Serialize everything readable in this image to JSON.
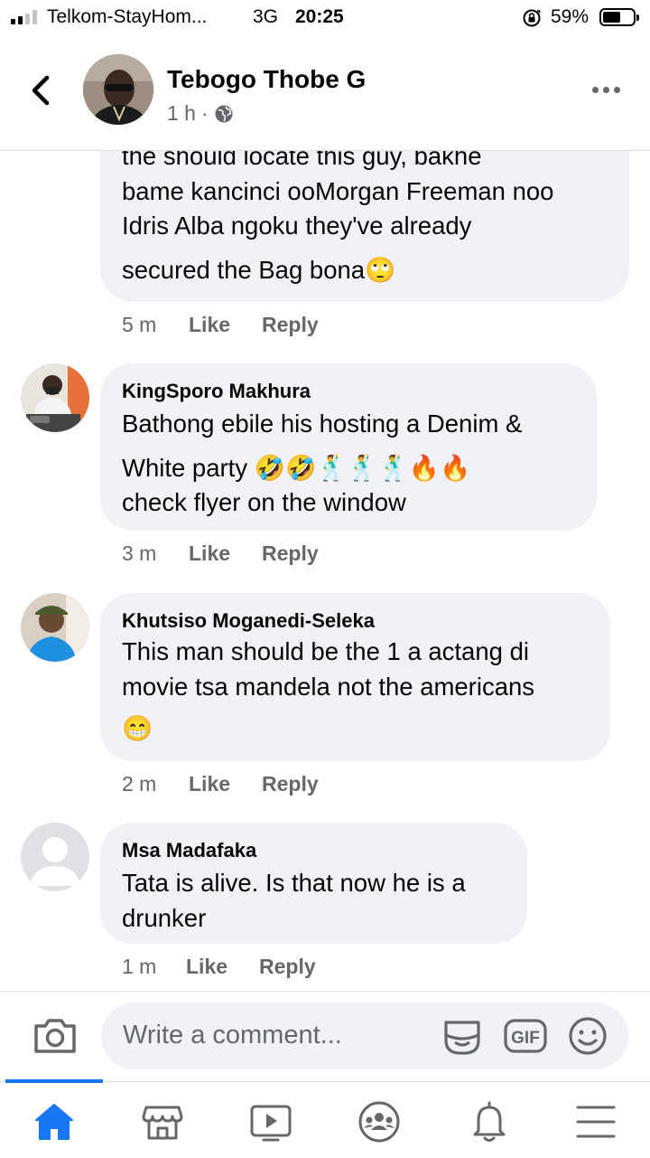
{
  "status_bar": {
    "carrier": "Telkom-StayHom...",
    "network": "3G",
    "time": "20:25",
    "battery": "59%",
    "battery_level": 0.59
  },
  "header": {
    "author": "Tebogo Thobe G",
    "time": "1 h",
    "separator": "·",
    "icons": [
      "back-chevron-icon",
      "globe-icon",
      "more-icon"
    ]
  },
  "comments": [
    {
      "author": "",
      "lines": [
        "the should locate this guy, bakhe",
        "bame kancinci ooMorgan Freeman noo",
        "Idris Alba ngoku they've already",
        "secured the Bag bona🙄"
      ],
      "time": "5 m",
      "like": "Like",
      "reply": "Reply"
    },
    {
      "author": "KingSporo Makhura",
      "lines": [
        "Bathong ebile his hosting a Denim &",
        "White party 🤣🤣🕺🕺🕺🔥🔥",
        "check flyer on the window"
      ],
      "time": "3 m",
      "like": "Like",
      "reply": "Reply"
    },
    {
      "author": "Khutsiso Moganedi-Seleka",
      "lines": [
        "This man should be the 1 a actang di",
        "movie tsa mandela not the americans",
        "😁"
      ],
      "time": "2 m",
      "like": "Like",
      "reply": "Reply"
    },
    {
      "author": "Msa Madafaka",
      "lines": [
        "Tata is alive. Is that now he is a",
        "drunker"
      ],
      "time": "1 m",
      "like": "Like",
      "reply": "Reply"
    }
  ],
  "composer": {
    "placeholder": "Write a comment...",
    "icons": [
      "camera-icon",
      "sticker-icon",
      "gif-icon",
      "emoji-icon"
    ],
    "gif_label": "GIF"
  },
  "bottom_nav": {
    "items": [
      "home-icon",
      "marketplace-icon",
      "watch-icon",
      "groups-icon",
      "notifications-icon",
      "menu-icon"
    ],
    "active": "home-icon",
    "accent": "#1877f2"
  }
}
